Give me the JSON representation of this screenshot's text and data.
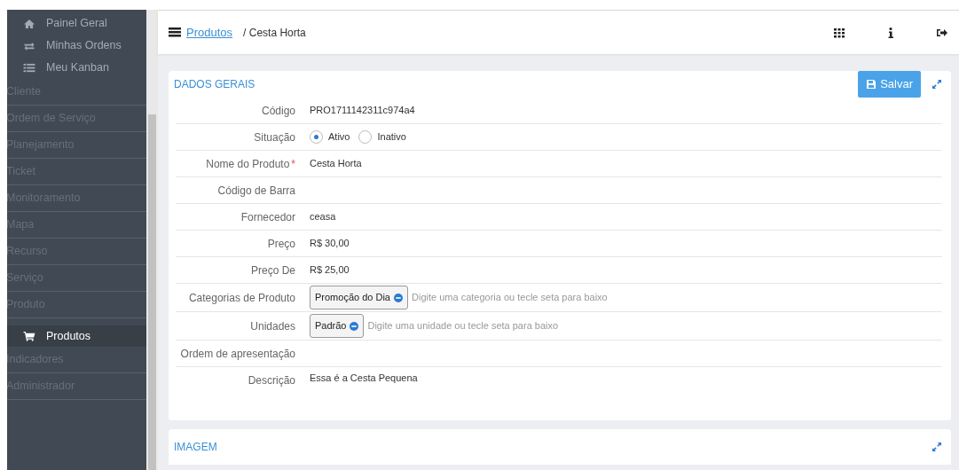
{
  "sidebar": {
    "items": [
      {
        "label": "Painel Geral",
        "kind": "link",
        "selected": false
      },
      {
        "label": "Minhas Ordens",
        "kind": "link",
        "selected": false
      },
      {
        "label": "Meu Kanban",
        "kind": "link",
        "selected": false
      },
      {
        "label": "Cliente",
        "kind": "section",
        "selected": false
      },
      {
        "label": "Ordem de Serviço",
        "kind": "section",
        "selected": false
      },
      {
        "label": "Planejamento",
        "kind": "section",
        "selected": false
      },
      {
        "label": "Ticket",
        "kind": "section",
        "selected": false
      },
      {
        "label": "Monitoramento",
        "kind": "section",
        "selected": false
      },
      {
        "label": "Mapa",
        "kind": "section",
        "selected": false
      },
      {
        "label": "Recurso",
        "kind": "section",
        "selected": false
      },
      {
        "label": "Serviço",
        "kind": "section",
        "selected": false
      },
      {
        "label": "Produto",
        "kind": "section",
        "selected": false
      },
      {
        "label": "Produtos",
        "kind": "link",
        "selected": true
      },
      {
        "label": "Indicadores",
        "kind": "section",
        "selected": false
      },
      {
        "label": "Administrador",
        "kind": "section",
        "selected": false
      }
    ]
  },
  "breadcrumb": {
    "link": "Produtos",
    "current": "/ Cesta Horta"
  },
  "card": {
    "title": "DADOS GERAIS",
    "save_button": "Salvar",
    "fields": [
      {
        "label": "Código",
        "kind": "text",
        "value": "PRO1711142311c974a4"
      },
      {
        "label": "Situação",
        "kind": "radio",
        "options": [
          {
            "label": "Ativo",
            "selected": true
          },
          {
            "label": "Inativo",
            "selected": false
          }
        ]
      },
      {
        "label": "Nome do Produto",
        "required_mark": "*",
        "kind": "text",
        "value": "Cesta Horta"
      },
      {
        "label": "Código de Barra",
        "kind": "text"
      },
      {
        "label": "Fornecedor",
        "kind": "text",
        "value": "ceasa"
      },
      {
        "label": "Preço",
        "kind": "text",
        "value": "R$ 30,00"
      },
      {
        "label": "Preço De",
        "kind": "text",
        "value": "R$ 25,00"
      },
      {
        "label": "Categorias de Produto",
        "kind": "tags",
        "tags": [
          "Promoção do Dia"
        ],
        "placeholder": "Digite uma categoria ou tecle seta para baixo"
      },
      {
        "label": "Unidades",
        "kind": "tags",
        "tags": [
          "Padrão"
        ],
        "placeholder": "Digite uma unidade ou tecle seta para baixo"
      },
      {
        "label": "Ordem de apresentação",
        "kind": "text"
      },
      {
        "label": "Descrição",
        "kind": "textarea",
        "value": "Essa é a Cesta Pequena"
      }
    ]
  },
  "image_card": {
    "title": "IMAGEM"
  }
}
